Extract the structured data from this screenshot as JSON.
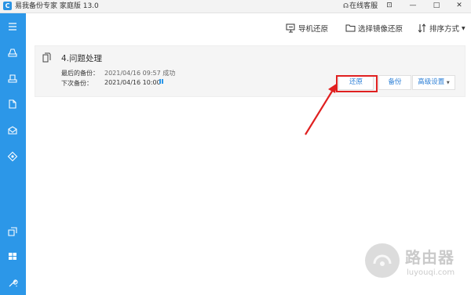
{
  "app": {
    "icon_letter": "C",
    "title": "易我备份专家 家庭版 13.0"
  },
  "titlebar": {
    "support_label": "在线客服",
    "support_icon": "headset-icon",
    "controls": {
      "menu": "⊡",
      "minimize": "—",
      "maximize": "□",
      "close": "✕"
    }
  },
  "sidebar": {
    "items": [
      {
        "icon": "menu-icon"
      },
      {
        "icon": "disk-backup-icon"
      },
      {
        "icon": "system-backup-icon"
      },
      {
        "icon": "file-backup-icon"
      },
      {
        "icon": "mail-backup-icon"
      },
      {
        "icon": "smart-backup-icon"
      },
      {
        "icon": "clone-icon"
      },
      {
        "icon": "windows-tools-icon"
      },
      {
        "icon": "tools-icon"
      }
    ],
    "color": "#2c97e8"
  },
  "toolbar": {
    "remote_restore": "导机还原",
    "select_image_restore": "选择镜像还原",
    "sort": "排序方式"
  },
  "task": {
    "title": "4.问题处理",
    "last_backup_label": "最后的备份：",
    "last_backup_value": "2021/04/16 09:57 成功",
    "next_backup_label": "下次备份：",
    "next_backup_value": "2021/04/16 10:00",
    "actions": {
      "restore": "还原",
      "backup": "备份",
      "advanced": "高级设置"
    }
  },
  "annotation": {
    "highlight_color": "#e02020"
  },
  "watermark": {
    "title": "路由器",
    "url": "luyouqi.com"
  }
}
